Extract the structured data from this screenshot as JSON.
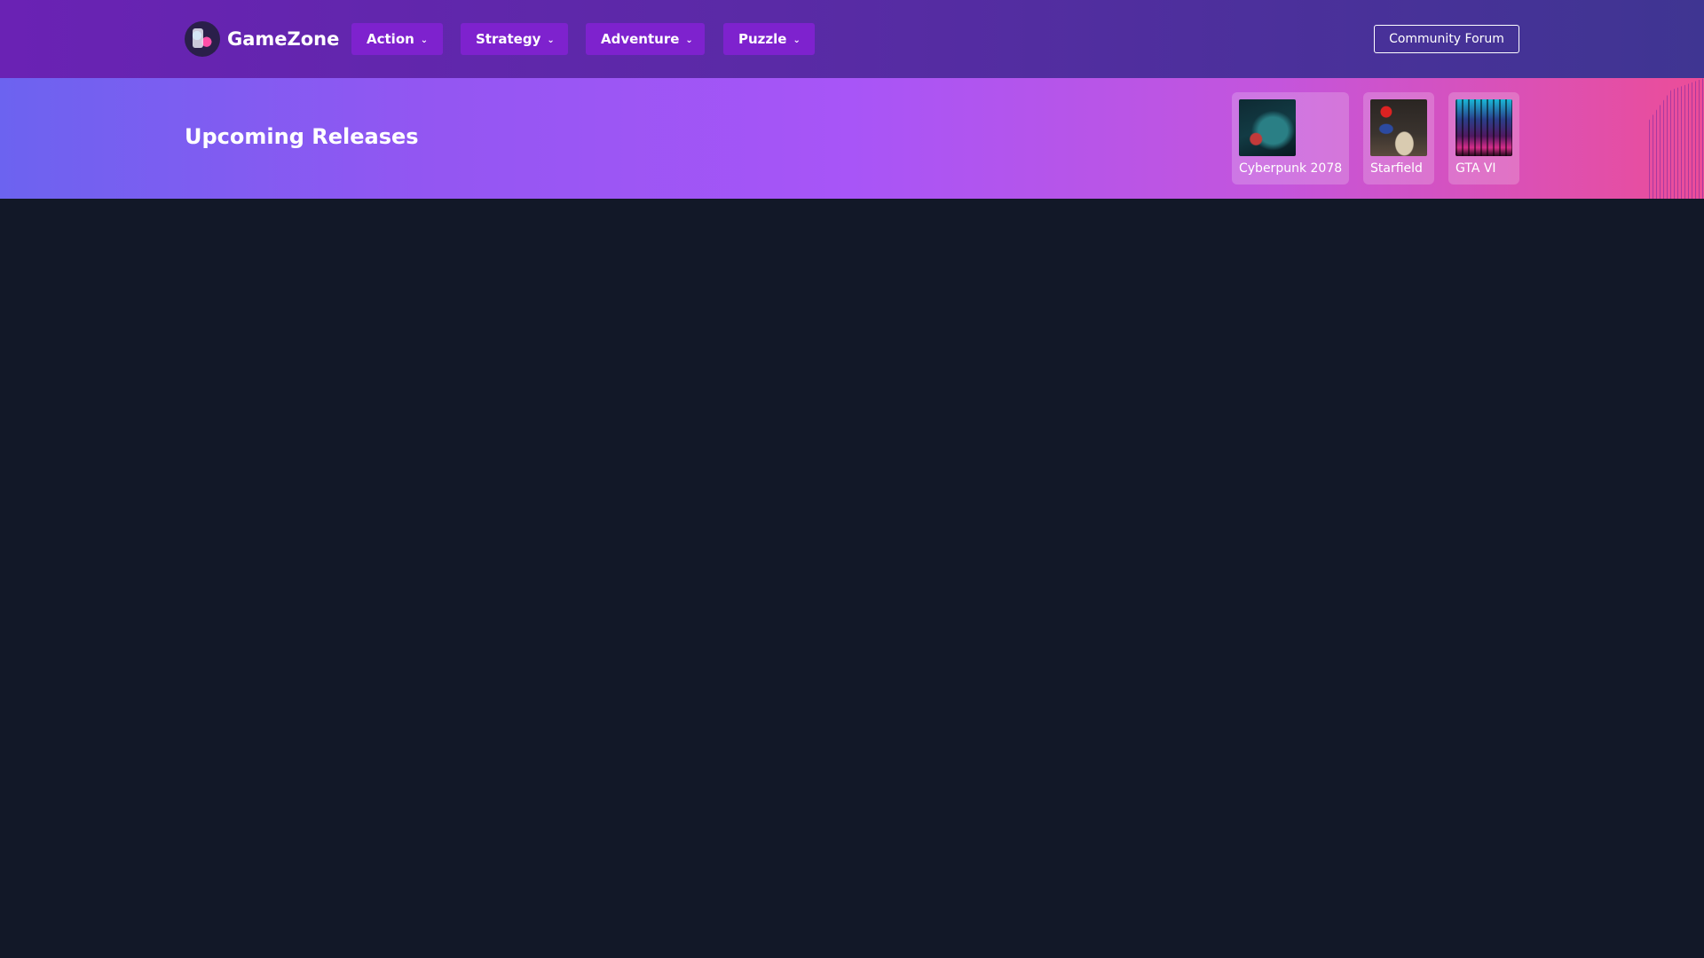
{
  "header": {
    "logo_text": "GameZone",
    "nav": [
      {
        "label": "Action"
      },
      {
        "label": "Strategy"
      },
      {
        "label": "Adventure"
      },
      {
        "label": "Puzzle"
      }
    ],
    "forum_button": "Community Forum",
    "chevron_icon": "chevron-down-icon"
  },
  "banner": {
    "title": "Upcoming Releases",
    "releases": [
      {
        "title": "Cyberpunk 2078",
        "thumb_icon": "game-cover"
      },
      {
        "title": "Starfield",
        "thumb_icon": "game-cover"
      },
      {
        "title": "GTA VI",
        "thumb_icon": "game-cover"
      }
    ]
  },
  "colors": {
    "nav_button": "#7e22ce",
    "page_background": "#121828",
    "banner_start": "#6c63f0",
    "banner_end": "#ec4d98"
  }
}
